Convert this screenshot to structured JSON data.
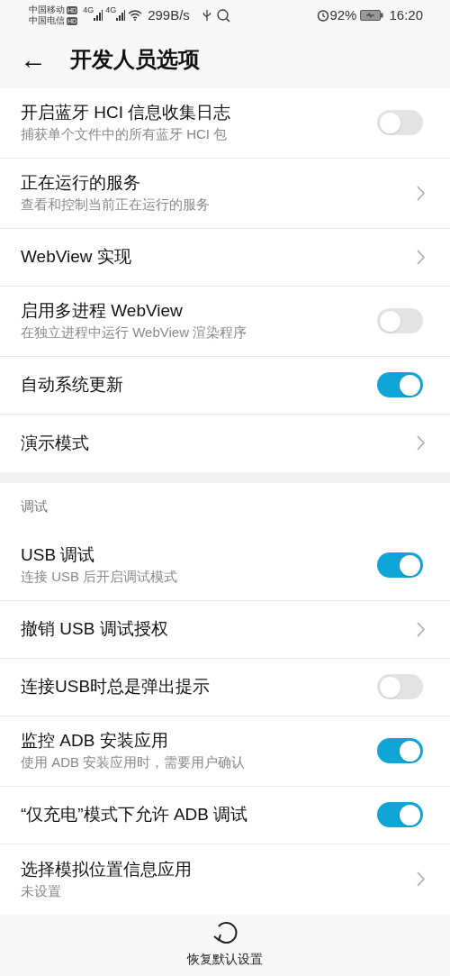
{
  "status_bar": {
    "carrier_1": "中国移动",
    "carrier_2": "中国电信",
    "hd_1": "HD",
    "hd_2": "HD",
    "net_1": "4G",
    "net_2": "4G",
    "speed": "299B/s",
    "battery_percent": "92%",
    "time": "16:20"
  },
  "header": {
    "back": "←",
    "title": "开发人员选项"
  },
  "sections": [
    {
      "items": [
        {
          "kind": "toggle",
          "title": "开启蓝牙 HCI 信息收集日志",
          "subtitle": "捕获单个文件中的所有蓝牙 HCI 包",
          "on": false
        },
        {
          "kind": "link",
          "title": "正在运行的服务",
          "subtitle": "查看和控制当前正在运行的服务"
        },
        {
          "kind": "link",
          "title": "WebView 实现"
        },
        {
          "kind": "toggle",
          "title": "启用多进程 WebView",
          "subtitle": "在独立进程中运行 WebView 渲染程序",
          "on": false
        },
        {
          "kind": "toggle",
          "title": "自动系统更新",
          "on": true
        },
        {
          "kind": "link",
          "title": "演示模式"
        }
      ]
    },
    {
      "heading": "调试",
      "items": [
        {
          "kind": "toggle",
          "title": "USB 调试",
          "subtitle": "连接 USB 后开启调试模式",
          "on": true
        },
        {
          "kind": "link",
          "title": "撤销 USB 调试授权"
        },
        {
          "kind": "toggle",
          "title": "连接USB时总是弹出提示",
          "on": false
        },
        {
          "kind": "toggle",
          "title": "监控 ADB 安装应用",
          "subtitle": "使用 ADB 安装应用时，需要用户确认",
          "on": true
        },
        {
          "kind": "toggle",
          "title": "“仅充电”模式下允许 ADB 调试",
          "on": true
        },
        {
          "kind": "link",
          "title": "选择模拟位置信息应用",
          "subtitle": "未设置"
        }
      ]
    }
  ],
  "footer": {
    "button": "恢复默认设置"
  }
}
